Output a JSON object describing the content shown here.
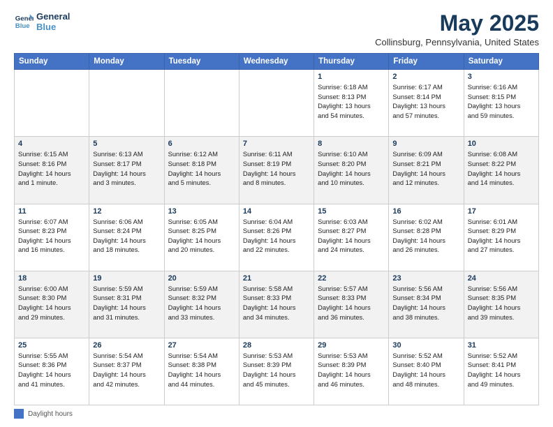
{
  "header": {
    "logo_line1": "General",
    "logo_line2": "Blue",
    "month_title": "May 2025",
    "subtitle": "Collinsburg, Pennsylvania, United States"
  },
  "days_of_week": [
    "Sunday",
    "Monday",
    "Tuesday",
    "Wednesday",
    "Thursday",
    "Friday",
    "Saturday"
  ],
  "weeks": [
    [
      {
        "day": "",
        "info": ""
      },
      {
        "day": "",
        "info": ""
      },
      {
        "day": "",
        "info": ""
      },
      {
        "day": "",
        "info": ""
      },
      {
        "day": "1",
        "info": "Sunrise: 6:18 AM\nSunset: 8:13 PM\nDaylight: 13 hours\nand 54 minutes."
      },
      {
        "day": "2",
        "info": "Sunrise: 6:17 AM\nSunset: 8:14 PM\nDaylight: 13 hours\nand 57 minutes."
      },
      {
        "day": "3",
        "info": "Sunrise: 6:16 AM\nSunset: 8:15 PM\nDaylight: 13 hours\nand 59 minutes."
      }
    ],
    [
      {
        "day": "4",
        "info": "Sunrise: 6:15 AM\nSunset: 8:16 PM\nDaylight: 14 hours\nand 1 minute."
      },
      {
        "day": "5",
        "info": "Sunrise: 6:13 AM\nSunset: 8:17 PM\nDaylight: 14 hours\nand 3 minutes."
      },
      {
        "day": "6",
        "info": "Sunrise: 6:12 AM\nSunset: 8:18 PM\nDaylight: 14 hours\nand 5 minutes."
      },
      {
        "day": "7",
        "info": "Sunrise: 6:11 AM\nSunset: 8:19 PM\nDaylight: 14 hours\nand 8 minutes."
      },
      {
        "day": "8",
        "info": "Sunrise: 6:10 AM\nSunset: 8:20 PM\nDaylight: 14 hours\nand 10 minutes."
      },
      {
        "day": "9",
        "info": "Sunrise: 6:09 AM\nSunset: 8:21 PM\nDaylight: 14 hours\nand 12 minutes."
      },
      {
        "day": "10",
        "info": "Sunrise: 6:08 AM\nSunset: 8:22 PM\nDaylight: 14 hours\nand 14 minutes."
      }
    ],
    [
      {
        "day": "11",
        "info": "Sunrise: 6:07 AM\nSunset: 8:23 PM\nDaylight: 14 hours\nand 16 minutes."
      },
      {
        "day": "12",
        "info": "Sunrise: 6:06 AM\nSunset: 8:24 PM\nDaylight: 14 hours\nand 18 minutes."
      },
      {
        "day": "13",
        "info": "Sunrise: 6:05 AM\nSunset: 8:25 PM\nDaylight: 14 hours\nand 20 minutes."
      },
      {
        "day": "14",
        "info": "Sunrise: 6:04 AM\nSunset: 8:26 PM\nDaylight: 14 hours\nand 22 minutes."
      },
      {
        "day": "15",
        "info": "Sunrise: 6:03 AM\nSunset: 8:27 PM\nDaylight: 14 hours\nand 24 minutes."
      },
      {
        "day": "16",
        "info": "Sunrise: 6:02 AM\nSunset: 8:28 PM\nDaylight: 14 hours\nand 26 minutes."
      },
      {
        "day": "17",
        "info": "Sunrise: 6:01 AM\nSunset: 8:29 PM\nDaylight: 14 hours\nand 27 minutes."
      }
    ],
    [
      {
        "day": "18",
        "info": "Sunrise: 6:00 AM\nSunset: 8:30 PM\nDaylight: 14 hours\nand 29 minutes."
      },
      {
        "day": "19",
        "info": "Sunrise: 5:59 AM\nSunset: 8:31 PM\nDaylight: 14 hours\nand 31 minutes."
      },
      {
        "day": "20",
        "info": "Sunrise: 5:59 AM\nSunset: 8:32 PM\nDaylight: 14 hours\nand 33 minutes."
      },
      {
        "day": "21",
        "info": "Sunrise: 5:58 AM\nSunset: 8:33 PM\nDaylight: 14 hours\nand 34 minutes."
      },
      {
        "day": "22",
        "info": "Sunrise: 5:57 AM\nSunset: 8:33 PM\nDaylight: 14 hours\nand 36 minutes."
      },
      {
        "day": "23",
        "info": "Sunrise: 5:56 AM\nSunset: 8:34 PM\nDaylight: 14 hours\nand 38 minutes."
      },
      {
        "day": "24",
        "info": "Sunrise: 5:56 AM\nSunset: 8:35 PM\nDaylight: 14 hours\nand 39 minutes."
      }
    ],
    [
      {
        "day": "25",
        "info": "Sunrise: 5:55 AM\nSunset: 8:36 PM\nDaylight: 14 hours\nand 41 minutes."
      },
      {
        "day": "26",
        "info": "Sunrise: 5:54 AM\nSunset: 8:37 PM\nDaylight: 14 hours\nand 42 minutes."
      },
      {
        "day": "27",
        "info": "Sunrise: 5:54 AM\nSunset: 8:38 PM\nDaylight: 14 hours\nand 44 minutes."
      },
      {
        "day": "28",
        "info": "Sunrise: 5:53 AM\nSunset: 8:39 PM\nDaylight: 14 hours\nand 45 minutes."
      },
      {
        "day": "29",
        "info": "Sunrise: 5:53 AM\nSunset: 8:39 PM\nDaylight: 14 hours\nand 46 minutes."
      },
      {
        "day": "30",
        "info": "Sunrise: 5:52 AM\nSunset: 8:40 PM\nDaylight: 14 hours\nand 48 minutes."
      },
      {
        "day": "31",
        "info": "Sunrise: 5:52 AM\nSunset: 8:41 PM\nDaylight: 14 hours\nand 49 minutes."
      }
    ]
  ],
  "footer": {
    "legend_label": "Daylight hours"
  }
}
